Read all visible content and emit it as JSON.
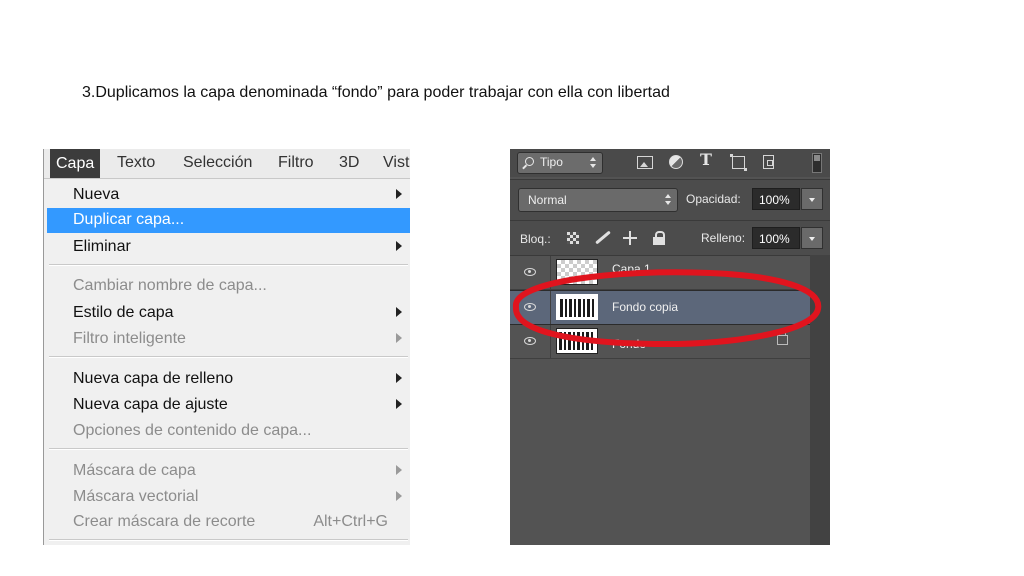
{
  "slide": {
    "title": "3.Duplicamos la capa denominada “fondo” para poder trabajar con ella con libertad"
  },
  "menubar": {
    "items": [
      "Capa",
      "Texto",
      "Selección",
      "Filtro",
      "3D",
      "Vist"
    ],
    "active": "Capa"
  },
  "menu": {
    "items": [
      {
        "label": "Nueva",
        "submenu": true,
        "enabled": true
      },
      {
        "label": "Duplicar capa...",
        "submenu": false,
        "enabled": true,
        "highlighted": true
      },
      {
        "label": "Eliminar",
        "submenu": true,
        "enabled": true
      },
      {
        "label": "Cambiar nombre de capa...",
        "submenu": false,
        "enabled": false
      },
      {
        "label": "Estilo de capa",
        "submenu": true,
        "enabled": true
      },
      {
        "label": "Filtro inteligente",
        "submenu": true,
        "enabled": false
      },
      {
        "label": "Nueva capa de relleno",
        "submenu": true,
        "enabled": true
      },
      {
        "label": "Nueva capa de ajuste",
        "submenu": true,
        "enabled": true
      },
      {
        "label": "Opciones de contenido de capa...",
        "submenu": false,
        "enabled": false
      },
      {
        "label": "Máscara de capa",
        "submenu": true,
        "enabled": false
      },
      {
        "label": "Máscara vectorial",
        "submenu": true,
        "enabled": false
      },
      {
        "label": "Crear máscara de recorte",
        "shortcut": "Alt+Ctrl+G",
        "submenu": false,
        "enabled": false
      }
    ]
  },
  "layers_panel": {
    "filter_label": "Tipo",
    "filter_icons": [
      "image-filter-icon",
      "adjustment-filter-icon",
      "type-filter-icon",
      "shape-filter-icon",
      "smart-object-filter-icon"
    ],
    "blend_mode": "Normal",
    "opacity_label": "Opacidad:",
    "opacity_value": "100%",
    "lock_label": "Bloq.:",
    "fill_label": "Relleno:",
    "fill_value": "100%",
    "layers": [
      {
        "name": "Capa 1",
        "visible": true,
        "selected": false,
        "locked": false
      },
      {
        "name": "Fondo copia",
        "visible": true,
        "selected": true,
        "locked": false
      },
      {
        "name": "Fondo",
        "visible": true,
        "selected": false,
        "locked": true
      }
    ],
    "annotation_color": "#e0141e"
  }
}
